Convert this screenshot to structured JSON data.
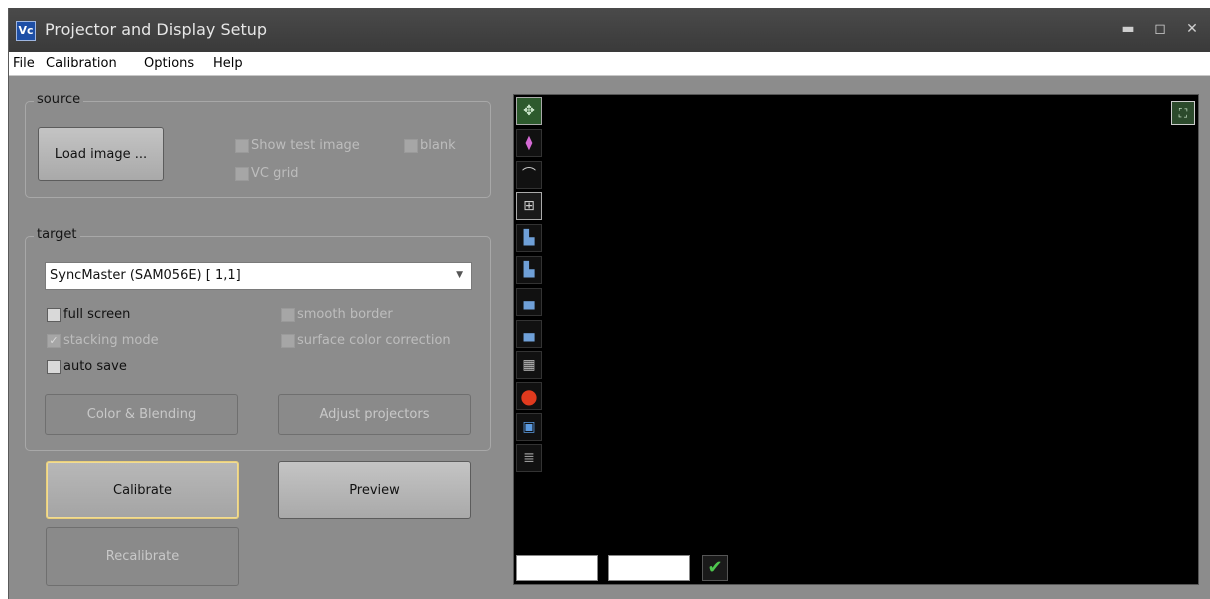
{
  "window": {
    "title": "Projector and Display Setup",
    "icon": "vc-app-icon",
    "icon_text": "Vc"
  },
  "menu": [
    {
      "label": "File"
    },
    {
      "label": "Calibration"
    },
    {
      "label": "Options"
    },
    {
      "label": "Help"
    }
  ],
  "source": {
    "label": "source",
    "load_button": "Load image ...",
    "show_test_image": {
      "label": "Show test image",
      "checked": false
    },
    "blank": {
      "label": "blank",
      "checked": false
    },
    "vc_grid": {
      "label": "VC grid",
      "checked": false
    }
  },
  "target": {
    "label": "target",
    "display_select": {
      "value": "SyncMaster (SAM056E)  [ 1,1]"
    },
    "full_screen": {
      "label": "full screen",
      "checked": false
    },
    "smooth_border": {
      "label": "smooth border",
      "checked": false
    },
    "stacking_mode": {
      "label": "stacking mode",
      "checked": true
    },
    "surface_color_correction": {
      "label": "surface color correction",
      "checked": false
    },
    "auto_save": {
      "label": "auto save",
      "checked": false
    },
    "color_blending_button": "Color & Blending",
    "adjust_projectors_button": "Adjust projectors"
  },
  "actions": {
    "calibrate": "Calibrate",
    "preview": "Preview",
    "recalibrate": "Recalibrate"
  },
  "toolbar": [
    "move-icon",
    "marker-icon",
    "curve-icon",
    "grid-points-icon",
    "add-column-icon",
    "remove-column-icon",
    "add-row-icon",
    "remove-row-icon",
    "mesh-icon",
    "record-icon",
    "save-icon",
    "list-icon"
  ],
  "colors": {
    "titlebar": "#3f3f3f",
    "panel": "#8c8c8c",
    "canvas": "#000000",
    "focus": "#e9cf7a",
    "record": "#e03a1e",
    "ok": "#4ec64e"
  }
}
